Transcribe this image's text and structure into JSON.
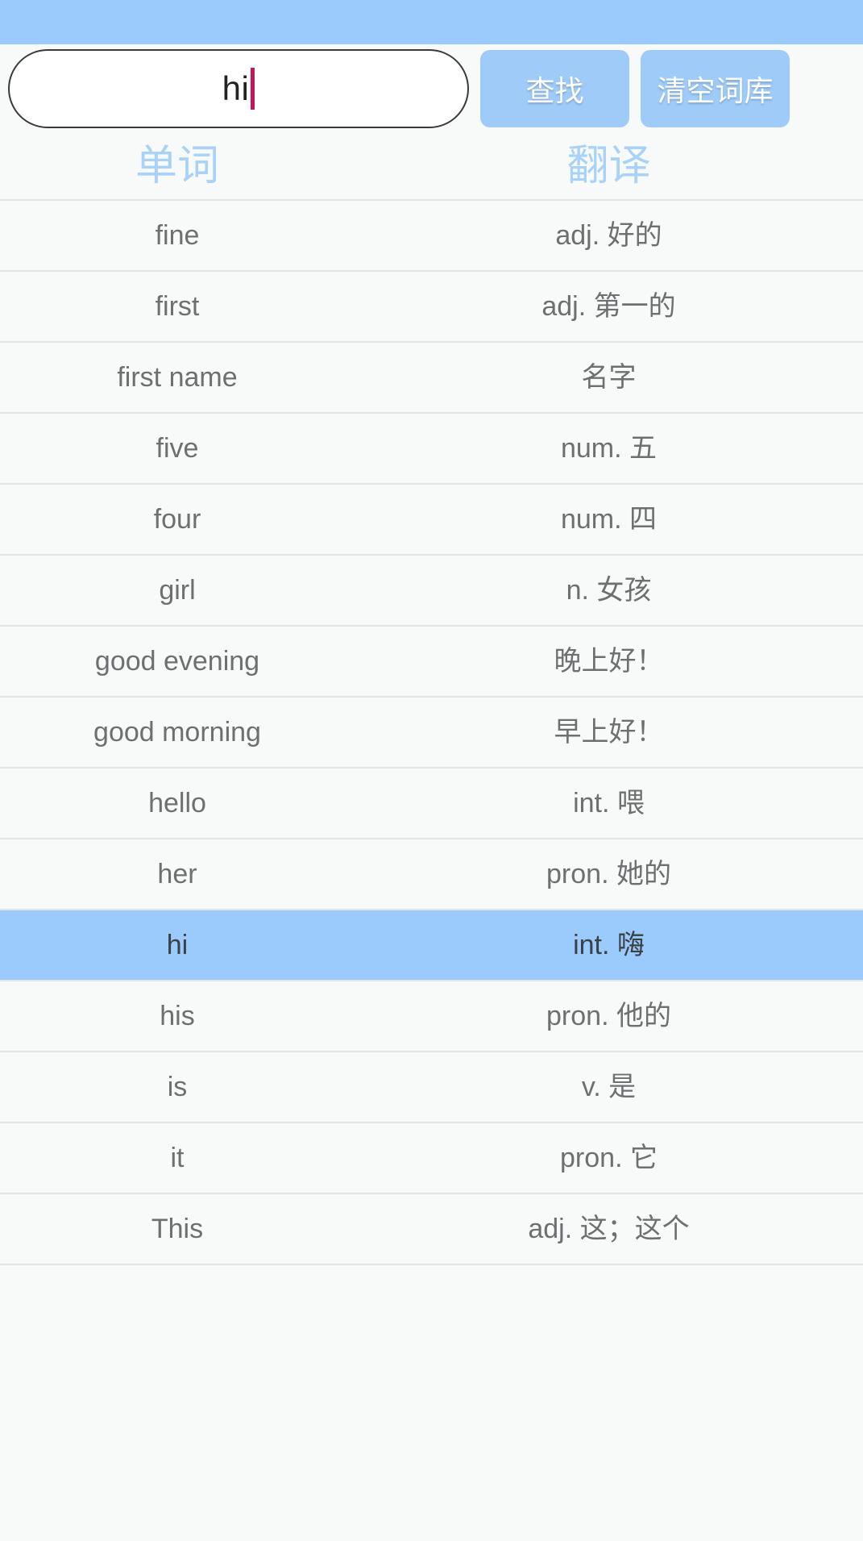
{
  "theme": {
    "status_bar_color": "#9acbfc",
    "accent_color": "#9fcbf9",
    "header_text_color": "#a8d2f8",
    "selected_row_color": "#9acbfc",
    "caret_color": "#c2185b",
    "page_background": "#f8f9f9",
    "row_divider_color": "#e2e4e6"
  },
  "search": {
    "value": "hi",
    "placeholder": "",
    "search_button_label": "查找",
    "clear_button_label": "清空词库"
  },
  "table": {
    "headers": {
      "word": "单词",
      "translation": "翻译"
    },
    "selected_index": 10,
    "rows": [
      {
        "word": "fine",
        "translation": "adj. 好的"
      },
      {
        "word": "first",
        "translation": "adj. 第一的"
      },
      {
        "word": "first name",
        "translation": "名字"
      },
      {
        "word": "five",
        "translation": "num. 五"
      },
      {
        "word": "four",
        "translation": "num. 四"
      },
      {
        "word": "girl",
        "translation": "n. 女孩"
      },
      {
        "word": "good evening",
        "translation": "晚上好！"
      },
      {
        "word": "good morning",
        "translation": "早上好！"
      },
      {
        "word": "hello",
        "translation": "int. 喂"
      },
      {
        "word": "her",
        "translation": "pron. 她的"
      },
      {
        "word": "hi",
        "translation": "int. 嗨"
      },
      {
        "word": "his",
        "translation": "pron. 他的"
      },
      {
        "word": "is",
        "translation": "v. 是"
      },
      {
        "word": "it",
        "translation": "pron. 它"
      },
      {
        "word": "This",
        "translation": "adj. 这；这个"
      }
    ]
  }
}
